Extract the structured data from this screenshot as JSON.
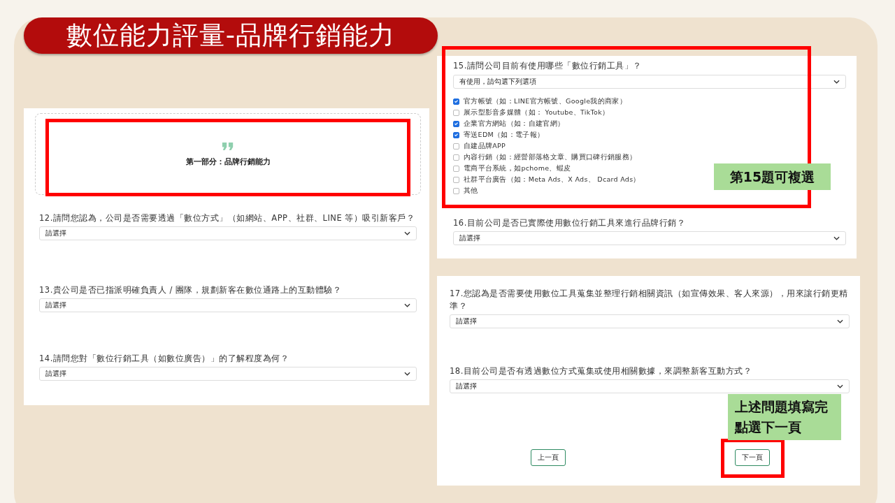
{
  "slide_title": "數位能力評量-品牌行銷能力",
  "left_panel": {
    "section_heading": "第一部分：品牌行銷能力",
    "questions": [
      {
        "label": "12.請問您認為，公司是否需要透過「數位方式」（如網站、APP、社群、LINE 等）吸引新客戶？",
        "select": "請選擇"
      },
      {
        "label": "13.貴公司是否已指派明確負責人 / 團隊，規劃新客在數位通路上的互動體驗？",
        "select": "請選擇"
      },
      {
        "label": "14.請問您對「數位行銷工具（如數位廣告）」的了解程度為何？",
        "select": "請選擇"
      }
    ]
  },
  "right_top_panel": {
    "questions": [
      {
        "label": "15.請問公司目前有使用哪些「數位行銷工具」？",
        "select": "有使用，請勾選下列選項",
        "options": [
          {
            "label": "官方帳號（如：LINE官方帳號、Google我的商家）",
            "checked": true
          },
          {
            "label": "展示型影音多媒體（如： Youtube、TikTok）",
            "checked": false
          },
          {
            "label": "企業官方網站（如：自建官網）",
            "checked": true
          },
          {
            "label": "寄送EDM（如：電子報）",
            "checked": true
          },
          {
            "label": "自建品牌APP",
            "checked": false
          },
          {
            "label": "內容行銷（如：經營部落格文章、購買口碑行銷服務）",
            "checked": false
          },
          {
            "label": "電商平台系統，如pchome、蝦皮",
            "checked": false
          },
          {
            "label": "社群平台廣告（如：Meta Ads、X Ads、 Dcard Ads）",
            "checked": false
          },
          {
            "label": "其他",
            "checked": false
          }
        ]
      },
      {
        "label": "16.目前公司是否已實際使用數位行銷工具來進行品牌行銷？",
        "select": "請選擇"
      }
    ]
  },
  "right_bottom_panel": {
    "questions": [
      {
        "label": "17.您認為是否需要使用數位工具蒐集並整理行銷相關資訊（如宣傳效果、客人來源），用來讓行銷更精準？",
        "select": "請選擇"
      },
      {
        "label": "18.目前公司是否有透過數位方式蒐集或使用相關數據，來調整新客互動方式？",
        "select": "請選擇"
      }
    ],
    "buttons": [
      "上一頁",
      "下一頁"
    ]
  },
  "annotations": [
    {
      "kind": "frame"
    },
    {
      "kind": "frame"
    },
    {
      "kind": "frame"
    },
    {
      "kind": "note",
      "lines": [
        "第15題可複選"
      ]
    },
    {
      "kind": "note",
      "lines": [
        "上述問題填寫完",
        "點選下一頁"
      ]
    }
  ]
}
